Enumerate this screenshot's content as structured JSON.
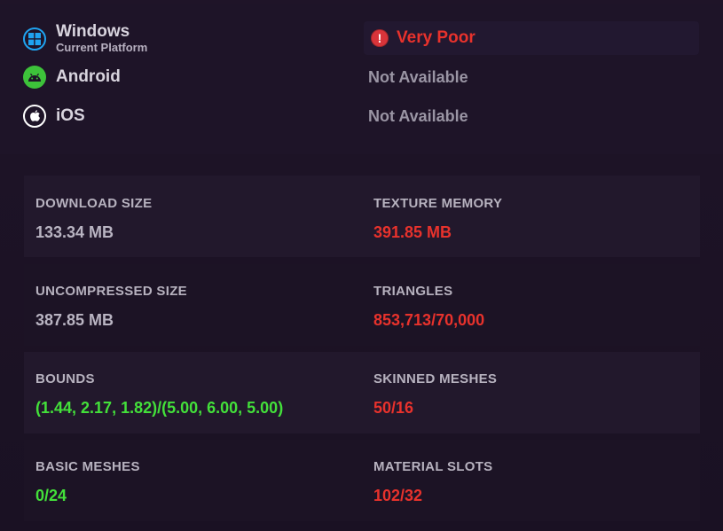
{
  "platforms": [
    {
      "name": "Windows",
      "sub": "Current Platform",
      "icon": "windows-icon",
      "color": "#1fa3f0"
    },
    {
      "name": "Android",
      "sub": "",
      "icon": "android-icon",
      "color": "#3dc23a"
    },
    {
      "name": "iOS",
      "sub": "",
      "icon": "apple-icon",
      "color": "#ffffff"
    }
  ],
  "rating": {
    "label": "Very Poor",
    "icon": "warning-icon",
    "color": "#e8322c"
  },
  "availability": {
    "android": "Not Available",
    "ios": "Not Available"
  },
  "stats": {
    "download_size": {
      "label": "DOWNLOAD SIZE",
      "value": "133.34 MB",
      "color": "#b9b4c2"
    },
    "texture_memory": {
      "label": "TEXTURE MEMORY",
      "value": "391.85 MB",
      "color": "#e8322c"
    },
    "uncompressed_size": {
      "label": "UNCOMPRESSED SIZE",
      "value": "387.85 MB",
      "color": "#b9b4c2"
    },
    "triangles": {
      "label": "TRIANGLES",
      "value": "853,713/70,000",
      "color": "#e8322c"
    },
    "bounds": {
      "label": "BOUNDS",
      "value": "(1.44, 2.17, 1.82)/(5.00, 6.00, 5.00)",
      "color": "#43e03a"
    },
    "skinned_meshes": {
      "label": "SKINNED MESHES",
      "value": "50/16",
      "color": "#e8322c"
    },
    "basic_meshes": {
      "label": "BASIC MESHES",
      "value": "0/24",
      "color": "#43e03a"
    },
    "material_slots": {
      "label": "MATERIAL SLOTS",
      "value": "102/32",
      "color": "#e8322c"
    }
  }
}
